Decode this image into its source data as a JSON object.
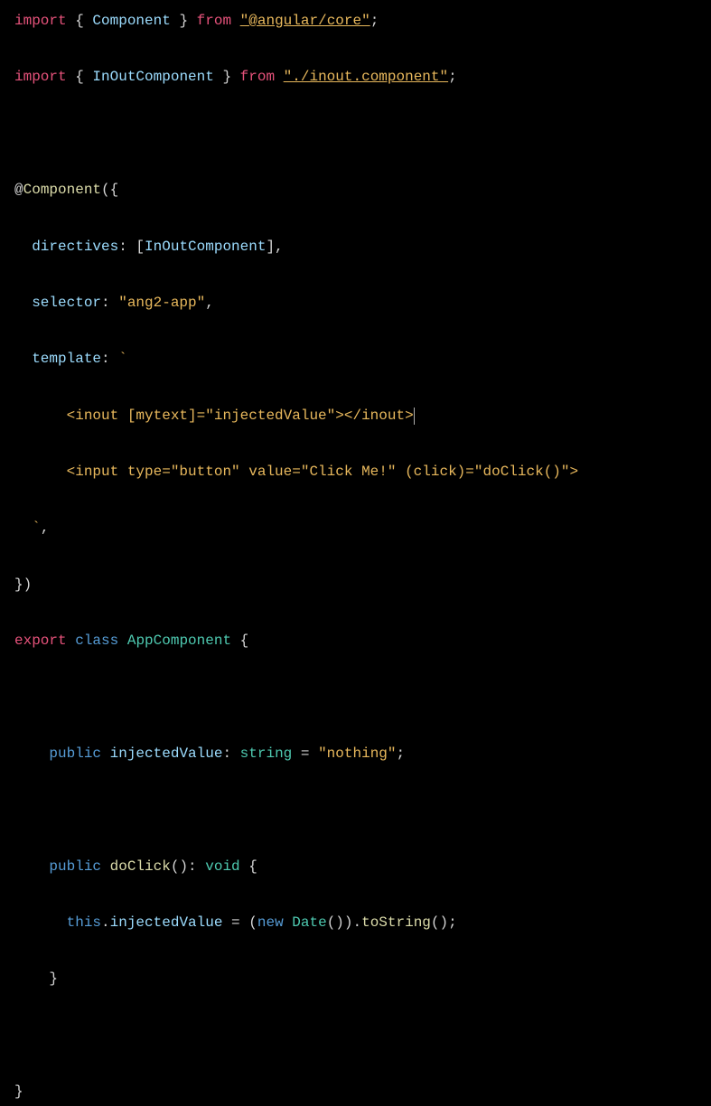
{
  "code": {
    "l1_import": "import",
    "l1_lbrace": " { ",
    "l1_component": "Component",
    "l1_rbrace": " } ",
    "l1_from": "from",
    "l1_sp": " ",
    "l1_str": "\"@angular/core\"",
    "l1_semi": ";",
    "l2_import": "import",
    "l2_lbrace": " { ",
    "l2_inout": "InOutComponent",
    "l2_rbrace": " } ",
    "l2_from": "from",
    "l2_sp": " ",
    "l2_str": "\"./inout.component\"",
    "l2_semi": ";",
    "l4_at": "@",
    "l4_comp": "Component",
    "l4_paren": "({",
    "l5_directives": "  directives",
    "l5_colon": ": [",
    "l5_inout": "InOutComponent",
    "l5_end": "],",
    "l6_selector": "  selector",
    "l6_colon": ": ",
    "l6_str": "\"ang2-app\"",
    "l6_end": ",",
    "l7_template": "  template",
    "l7_colon": ": ",
    "l7_tick": "`",
    "l8_indent": "      ",
    "l8_text": "<inout [mytext]=\"injectedValue\"></inout>",
    "l9_indent": "      ",
    "l9_text": "<input type=\"button\" value=\"Click Me!\" (click)=\"doClick()\">",
    "l10_indent": "  ",
    "l10_tick": "`",
    "l10_end": ",",
    "l11_close": "})",
    "l12_export": "export",
    "l12_sp1": " ",
    "l12_class": "class",
    "l12_sp2": " ",
    "l12_name": "AppComponent",
    "l12_sp3": " ",
    "l12_brace": "{",
    "l14_indent": "    ",
    "l14_public": "public",
    "l14_sp1": " ",
    "l14_ident": "injectedValue",
    "l14_colon": ": ",
    "l14_type": "string",
    "l14_eq": " = ",
    "l14_str": "\"nothing\"",
    "l14_semi": ";",
    "l16_indent": "    ",
    "l16_public": "public",
    "l16_sp1": " ",
    "l16_method": "doClick",
    "l16_paren": "(): ",
    "l16_void": "void",
    "l16_sp2": " ",
    "l16_brace": "{",
    "l17_indent": "      ",
    "l17_this": "this",
    "l17_dot": ".",
    "l17_prop": "injectedValue",
    "l17_eq": " = (",
    "l17_new": "new",
    "l17_sp": " ",
    "l17_date": "Date",
    "l17_p2": "()).",
    "l17_tostr": "toString",
    "l17_end": "();",
    "l18_indent": "    ",
    "l18_brace": "}",
    "l20_brace": "}"
  }
}
